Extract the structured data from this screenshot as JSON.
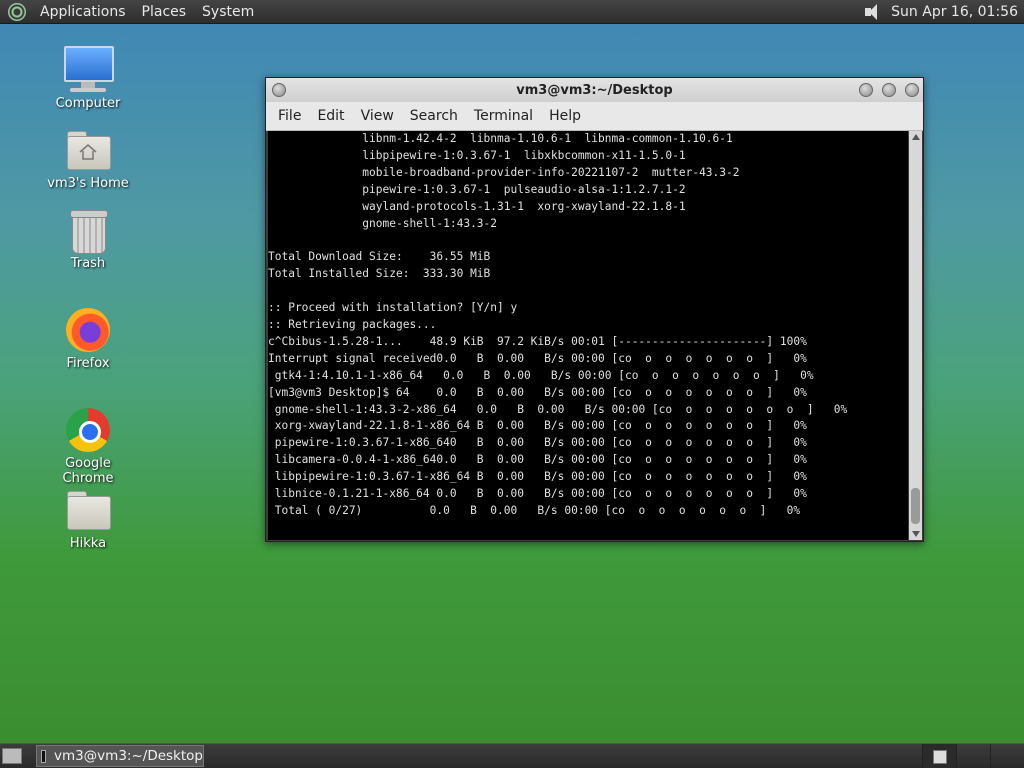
{
  "top_panel": {
    "menus": [
      "Applications",
      "Places",
      "System"
    ],
    "clock": "Sun Apr 16, 01:56"
  },
  "desktop_icons": [
    {
      "label": "Computer",
      "icon": "computer-icon"
    },
    {
      "label": "vm3's Home",
      "icon": "home-folder-icon"
    },
    {
      "label": "Trash",
      "icon": "trash-icon"
    },
    {
      "label": "Firefox",
      "icon": "firefox-icon"
    },
    {
      "label": "Google Chrome",
      "icon": "chrome-icon"
    },
    {
      "label": "Hikka",
      "icon": "folder-icon"
    }
  ],
  "window": {
    "title": "vm3@vm3:~/Desktop",
    "menus": [
      "File",
      "Edit",
      "View",
      "Search",
      "Terminal",
      "Help"
    ],
    "terminal_text": "              libnm-1.42.4-2  libnma-1.10.6-1  libnma-common-1.10.6-1\n              libpipewire-1:0.3.67-1  libxkbcommon-x11-1.5.0-1\n              mobile-broadband-provider-info-20221107-2  mutter-43.3-2\n              pipewire-1:0.3.67-1  pulseaudio-alsa-1:1.2.7.1-2\n              wayland-protocols-1.31-1  xorg-xwayland-22.1.8-1\n              gnome-shell-1:43.3-2\n\nTotal Download Size:    36.55 MiB\nTotal Installed Size:  333.30 MiB\n\n:: Proceed with installation? [Y/n] y\n:: Retrieving packages...\nc^Cbibus-1.5.28-1...    48.9 KiB  97.2 KiB/s 00:01 [----------------------] 100%\nInterrupt signal received0.0   B  0.00   B/s 00:00 [co  o  o  o  o  o  o  ]   0%\n gtk4-1:4.10.1-1-x86_64   0.0   B  0.00   B/s 00:00 [co  o  o  o  o  o  o  ]   0%\n[vm3@vm3 Desktop]$ 64    0.0   B  0.00   B/s 00:00 [co  o  o  o  o  o  o  ]   0%\n gnome-shell-1:43.3-2-x86_64   0.0   B  0.00   B/s 00:00 [co  o  o  o  o  o  o  ]   0%\n xorg-xwayland-22.1.8-1-x86_64 B  0.00   B/s 00:00 [co  o  o  o  o  o  o  ]   0%\n pipewire-1:0.3.67-1-x86_640   B  0.00   B/s 00:00 [co  o  o  o  o  o  o  ]   0%\n libcamera-0.0.4-1-x86_640.0   B  0.00   B/s 00:00 [co  o  o  o  o  o  o  ]   0%\n libpipewire-1:0.3.67-1-x86_64 B  0.00   B/s 00:00 [co  o  o  o  o  o  o  ]   0%\n libnice-0.1.21-1-x86_64 0.0   B  0.00   B/s 00:00 [co  o  o  o  o  o  o  ]   0%\n Total ( 0/27)          0.0   B  0.00   B/s 00:00 [co  o  o  o  o  o  o  ]   0%"
  },
  "taskbar": {
    "task_label": "vm3@vm3:~/Desktop"
  }
}
